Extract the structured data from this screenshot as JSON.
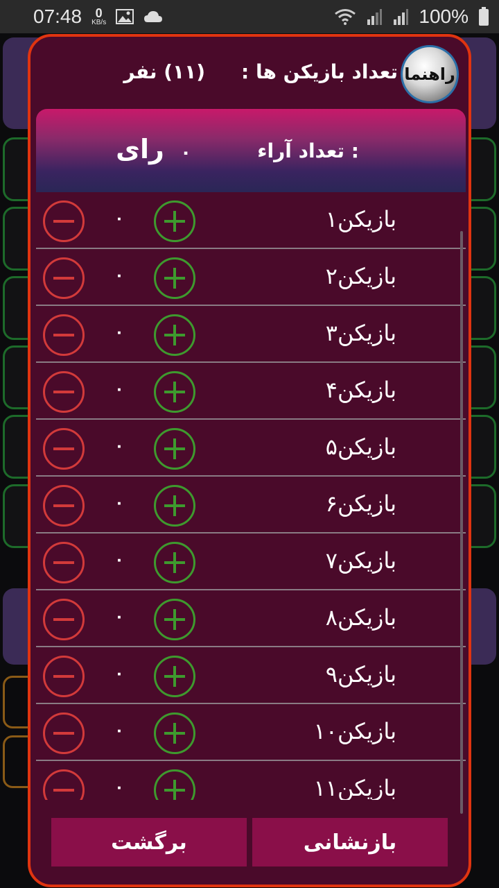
{
  "status_bar": {
    "time": "07:48",
    "net_speed_value": "0",
    "net_speed_unit": "KB/s",
    "battery": "100%"
  },
  "dialog": {
    "help_label": "راهنما",
    "players_label": "تعداد بازیکن ها :",
    "players_count": "(۱۱) نفر",
    "votes_label": "تعداد آراء :",
    "votes_value": "۰",
    "votes_unit": "رای",
    "players": [
      {
        "name": "بازیکن۱",
        "votes": "۰"
      },
      {
        "name": "بازیکن۲",
        "votes": "۰"
      },
      {
        "name": "بازیکن۳",
        "votes": "۰"
      },
      {
        "name": "بازیکن۴",
        "votes": "۰"
      },
      {
        "name": "بازیکن۵",
        "votes": "۰"
      },
      {
        "name": "بازیکن۶",
        "votes": "۰"
      },
      {
        "name": "بازیکن۷",
        "votes": "۰"
      },
      {
        "name": "بازیکن۸",
        "votes": "۰"
      },
      {
        "name": "بازیکن۹",
        "votes": "۰"
      },
      {
        "name": "بازیکن۱۰",
        "votes": "۰"
      },
      {
        "name": "بازیکن۱۱",
        "votes": "۰"
      }
    ],
    "back_label": "برگشت",
    "reset_label": "بازنشانی"
  },
  "colors": {
    "dialog_bg": "#4a0a2a",
    "dialog_border": "#e03410",
    "button_bg": "#8a0f49",
    "plus": "#3e9a2e",
    "minus": "#d23a3a"
  }
}
